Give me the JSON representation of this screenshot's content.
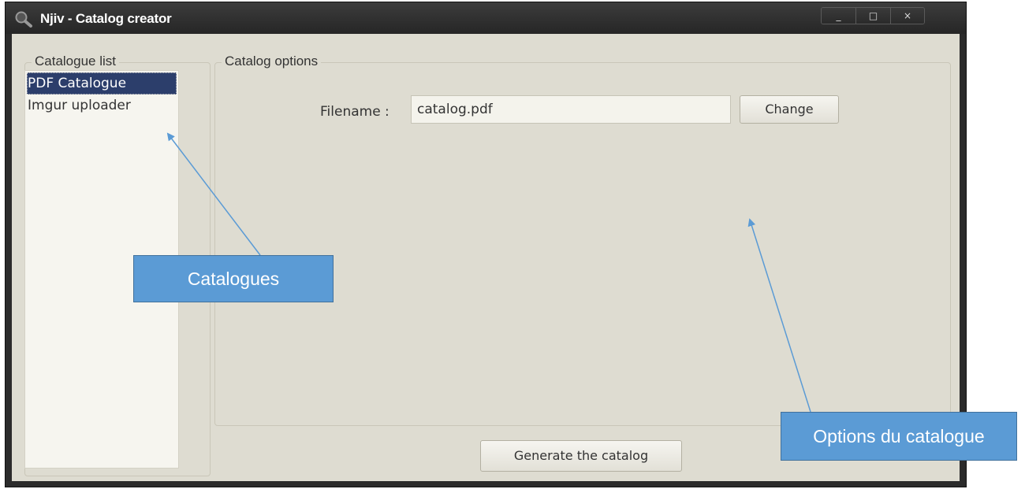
{
  "window": {
    "title": "Njiv - Catalog creator",
    "app_icon": "magnifier-icon",
    "controls": {
      "minimize": "_",
      "maximize": "□",
      "close": "×"
    }
  },
  "catalogue_list": {
    "title": "Catalogue list",
    "items": [
      {
        "label": "PDF Catalogue",
        "selected": true
      },
      {
        "label": "Imgur uploader",
        "selected": false
      }
    ]
  },
  "catalog_options": {
    "title": "Catalog options",
    "filename_label": "Filename :",
    "filename_value": "catalog.pdf",
    "change_label": "Change"
  },
  "generate_label": "Generate the catalog",
  "annotations": {
    "catalogues": "Catalogues",
    "options": "Options du catalogue"
  },
  "colors": {
    "titlebar": "#2b2b2b",
    "client_bg": "#dedcd1",
    "selection": "#2c3e6b",
    "callout": "#5b9bd5",
    "arrow": "#5b9bd5"
  }
}
